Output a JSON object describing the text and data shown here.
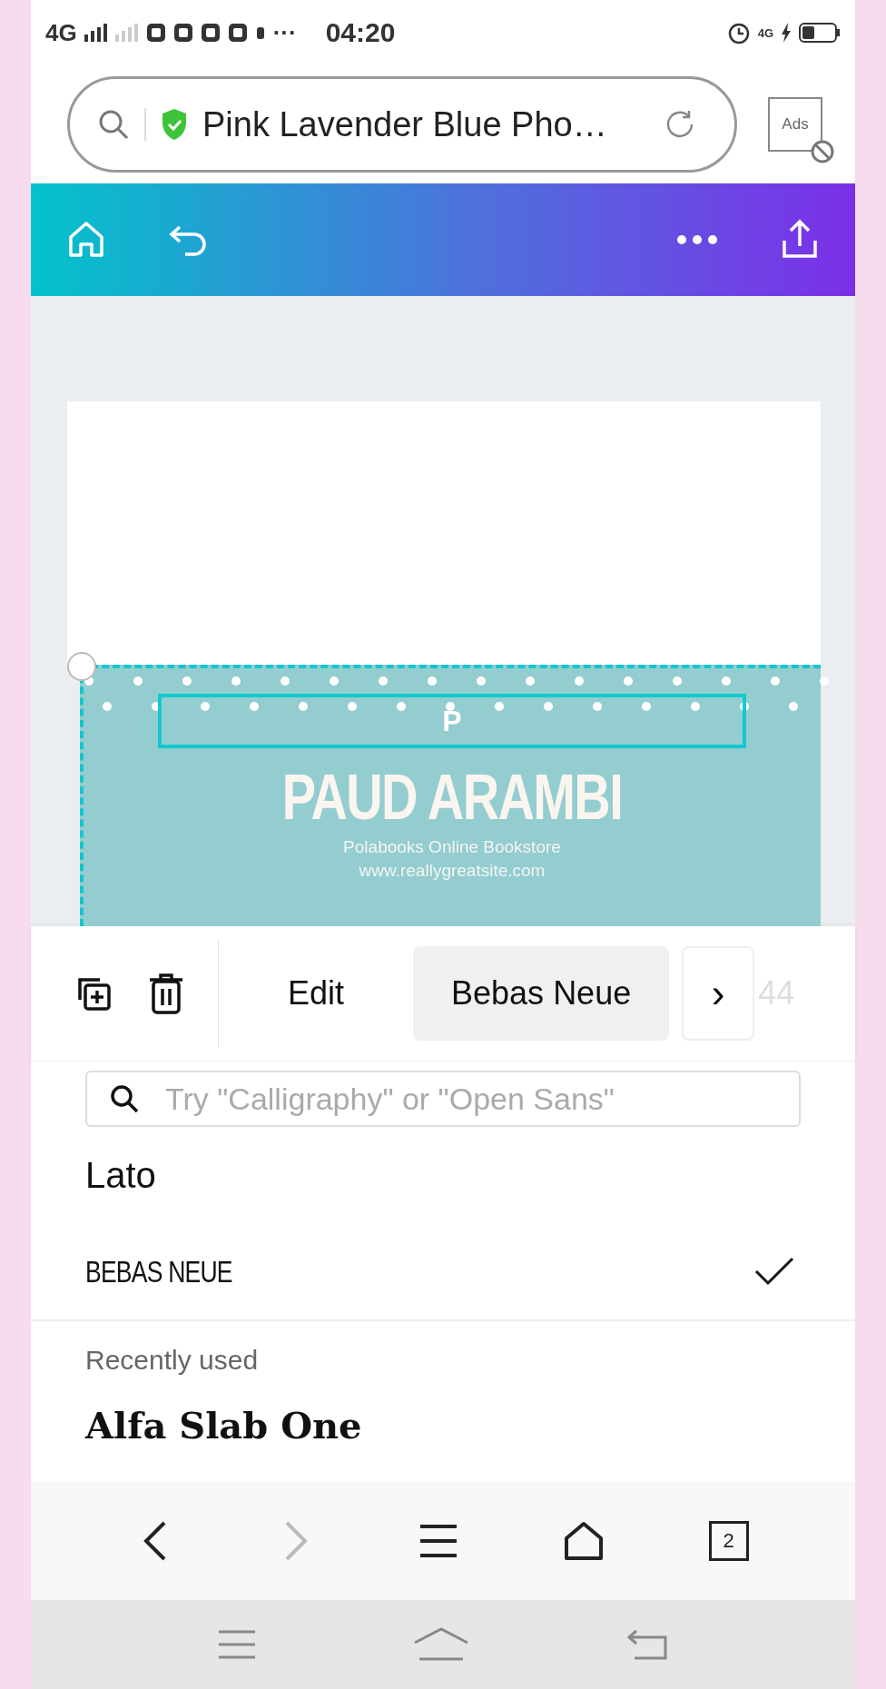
{
  "status_bar": {
    "network": "4G",
    "more": "···",
    "time": "04:20",
    "data": "4G"
  },
  "browser": {
    "title": "Pink Lavender Blue Pho…",
    "ads": "Ads"
  },
  "design": {
    "top_text": "P",
    "title": "PAUD ARAMBI",
    "subtitle": "Polabooks Online Bookstore",
    "website": "www.reallygreatsite.com"
  },
  "toolbar": {
    "buttons": [
      {
        "label": "Edit",
        "selected": false
      },
      {
        "label": "Bebas Neue",
        "selected": true
      }
    ],
    "next": "›",
    "size": "44"
  },
  "font_panel": {
    "search_placeholder": "Try \"Calligraphy\" or \"Open Sans\"",
    "fonts": [
      {
        "name": "Lato",
        "kind": "sans",
        "checked": false
      },
      {
        "name": "BEBAS NEUE",
        "kind": "condensed",
        "checked": true
      }
    ],
    "recent_heading": "Recently used",
    "recent": [
      {
        "name": "Alfa Slab One",
        "kind": "slab"
      }
    ]
  },
  "browser_nav": {
    "tabs": "2"
  }
}
